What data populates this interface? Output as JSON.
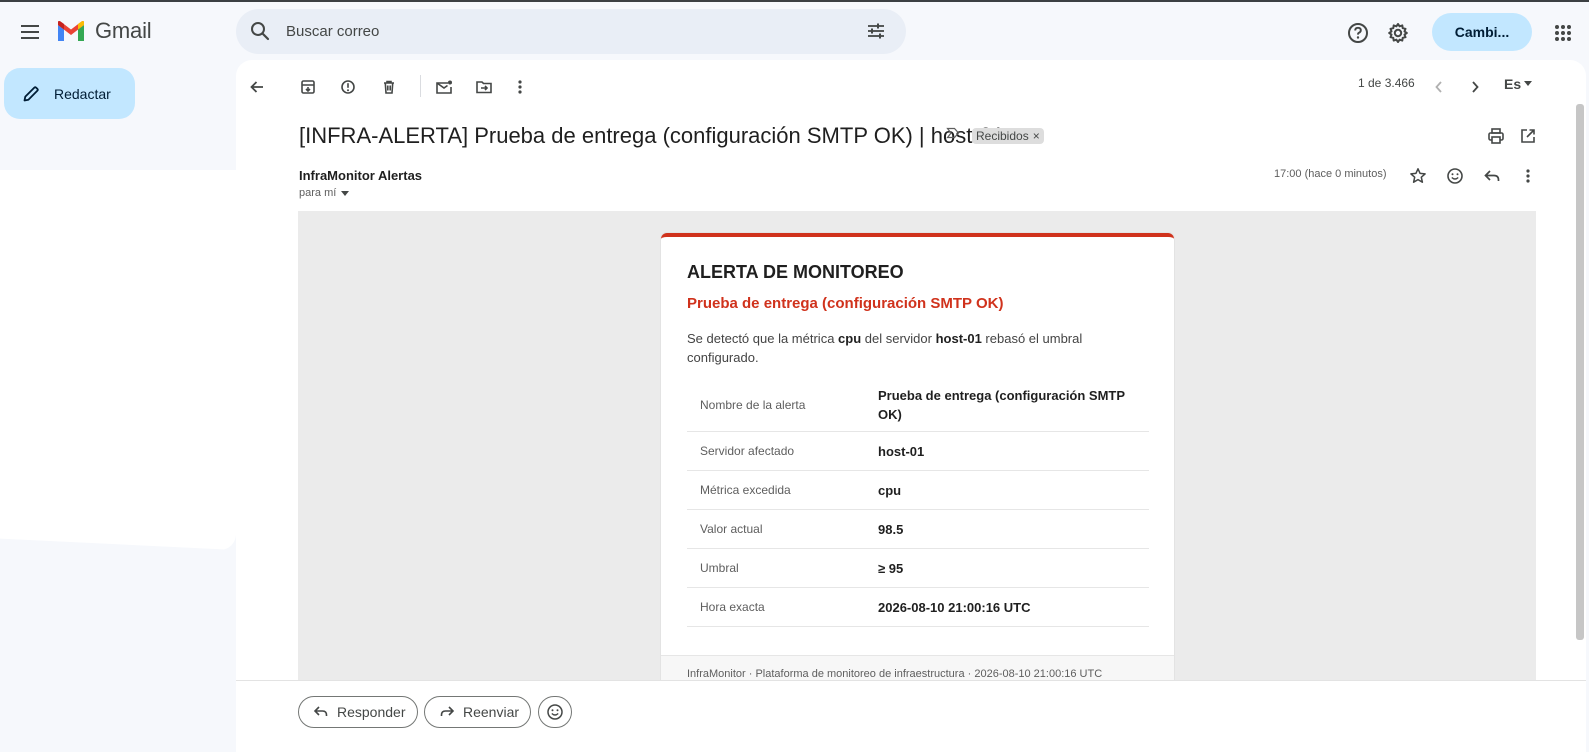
{
  "header": {
    "app_name": "Gmail",
    "search_placeholder": "Buscar correo",
    "account_label": "Cambi..."
  },
  "sidebar": {
    "compose_label": "Redactar"
  },
  "toolbar": {
    "pager": "1 de 3.466",
    "language": "Es"
  },
  "message": {
    "subject": "[INFRA-ALERTA] Prueba de entrega (configuración SMTP OK) | host-01",
    "label_chip": "Recibidos",
    "label_chip_close": "×",
    "sender": "InfraMonitor Alertas",
    "recipient": "para mí",
    "time": "17:00 (hace 0 minutos)"
  },
  "alert": {
    "title": "ALERTA DE MONITOREO",
    "subtitle": "Prueba de entrega (configuración SMTP OK)",
    "desc_1": "Se detectó que la métrica ",
    "desc_metric": "cpu",
    "desc_2": " del servidor ",
    "desc_host": "host-01",
    "desc_3": " rebasó el umbral configurado.",
    "rows": [
      {
        "label": "Nombre de la alerta",
        "value": "Prueba de entrega (configuración SMTP OK)"
      },
      {
        "label": "Servidor afectado",
        "value": "host-01"
      },
      {
        "label": "Métrica excedida",
        "value": "cpu"
      },
      {
        "label": "Valor actual",
        "value": "98.5"
      },
      {
        "label": "Umbral",
        "value": "≥ 95"
      },
      {
        "label": "Hora exacta",
        "value": "2026-08-10 21:00:16 UTC"
      }
    ],
    "footer": "InfraMonitor · Plataforma de monitoreo de infraestructura · 2026-08-10 21:00:16 UTC"
  },
  "actions": {
    "reply_label": "Responder",
    "forward_label": "Reenviar"
  },
  "colors": {
    "accent": "#c2e7ff",
    "alert_red": "#d0321c",
    "search_bg": "#e9eef6"
  }
}
